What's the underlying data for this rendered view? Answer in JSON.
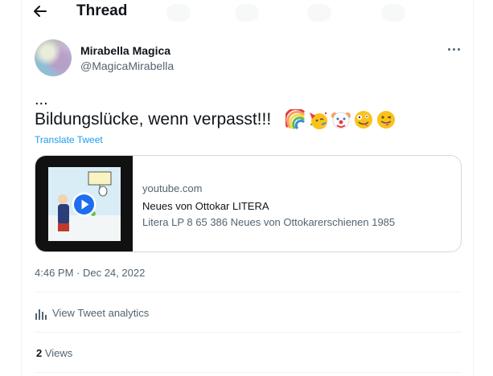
{
  "header": {
    "title": "Thread"
  },
  "author": {
    "name": "Mirabella Magica",
    "handle": "@MagicaMirabella"
  },
  "tweet": {
    "ellipsis": "...",
    "text": "Bildungslücke, wenn verpasst!!!",
    "emojis": [
      "rainbow-emoji",
      "partying-face-emoji",
      "clown-face-emoji",
      "zany-face-emoji",
      "winking-tongue-emoji"
    ],
    "translate_label": "Translate Tweet"
  },
  "card": {
    "domain": "youtube.com",
    "title": "Neues von Ottokar LITERA",
    "description": "Litera LP 8 65 386 Neues von Ottokarerschienen 1985"
  },
  "timestamp": "4:46 PM · Dec 24, 2022",
  "analytics_label": "View Tweet analytics",
  "views": {
    "count": "2",
    "label": "Views"
  },
  "colors": {
    "link": "#1d9bf0",
    "secondary": "#536471",
    "border": "#cfd9de",
    "play": "#1d6ff0"
  }
}
